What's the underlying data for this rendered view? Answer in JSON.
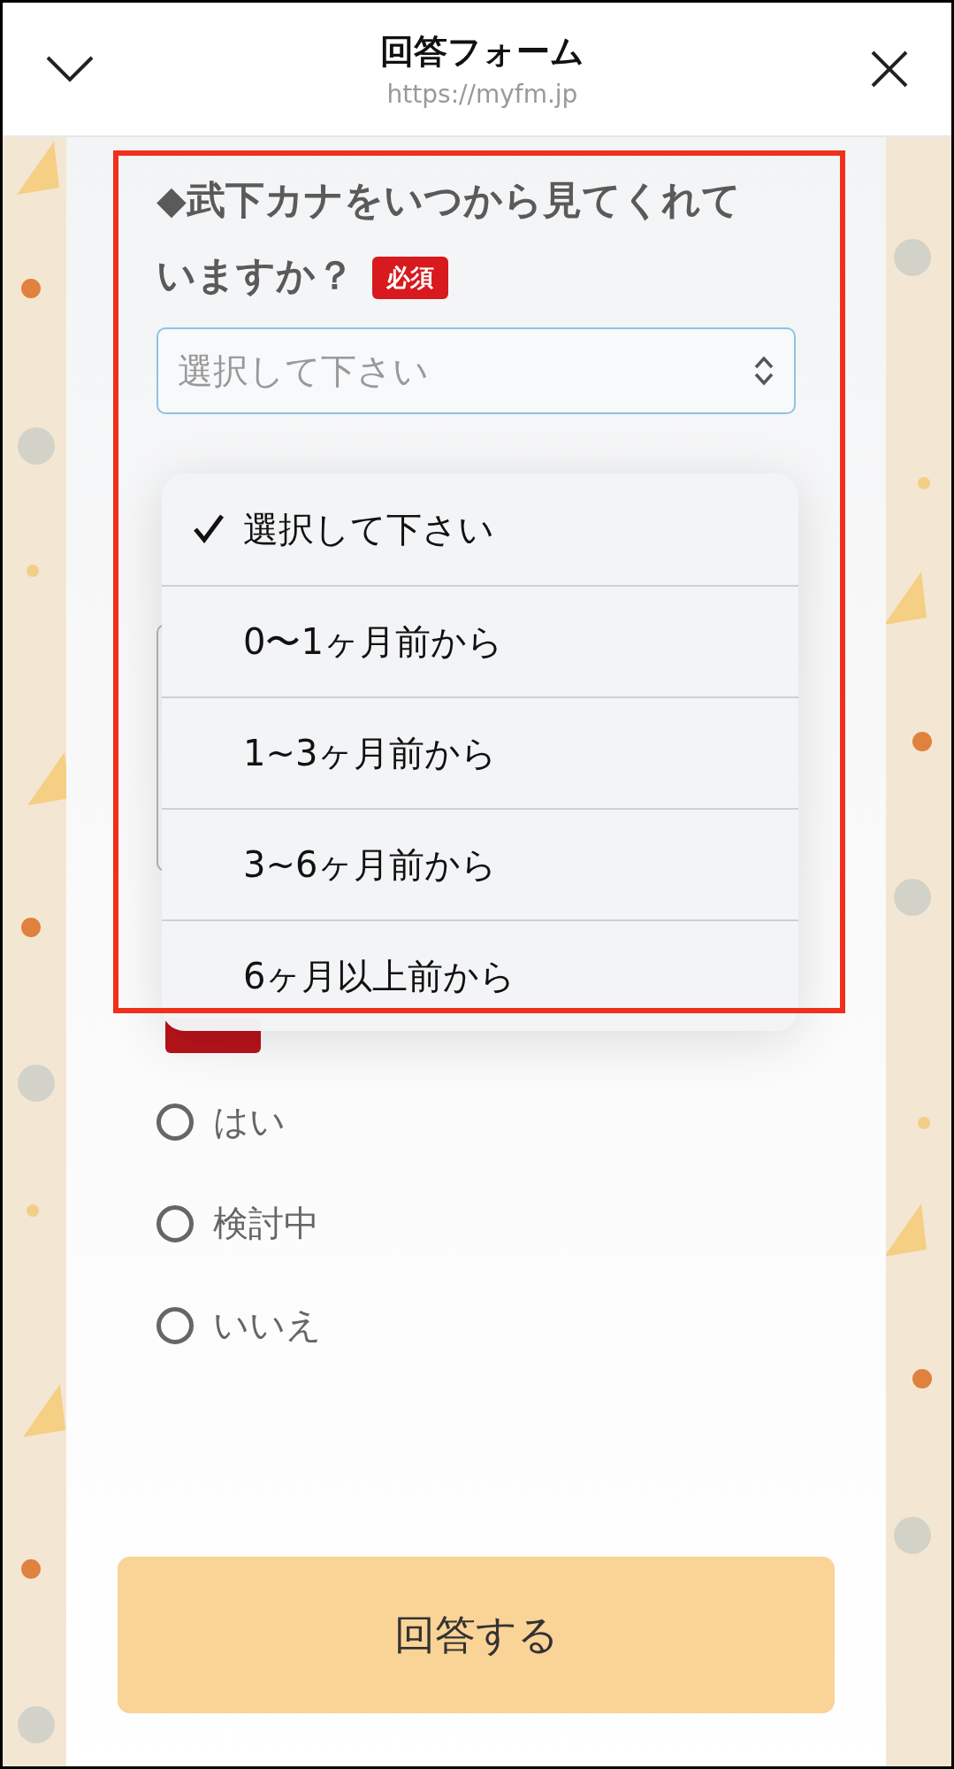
{
  "header": {
    "title": "回答フォーム",
    "url": "https://myfm.jp"
  },
  "question": {
    "text_lines": [
      "◆武下カナをいつから見てくれて",
      "いますか？"
    ],
    "required_badge": "必須",
    "select": {
      "placeholder": "選択して下さい"
    }
  },
  "dropdown": {
    "options": [
      {
        "label": "選択して下さい",
        "selected": true
      },
      {
        "label": "0〜1ヶ月前から",
        "selected": false
      },
      {
        "label": "1~3ヶ月前から",
        "selected": false
      },
      {
        "label": "3~6ヶ月前から",
        "selected": false
      },
      {
        "label": "6ヶ月以上前から",
        "selected": false
      }
    ]
  },
  "radio_options": [
    {
      "label": "はい",
      "selected": false
    },
    {
      "label": "検討中",
      "selected": false
    },
    {
      "label": "いいえ",
      "selected": false
    }
  ],
  "submit_button": "回答する"
}
